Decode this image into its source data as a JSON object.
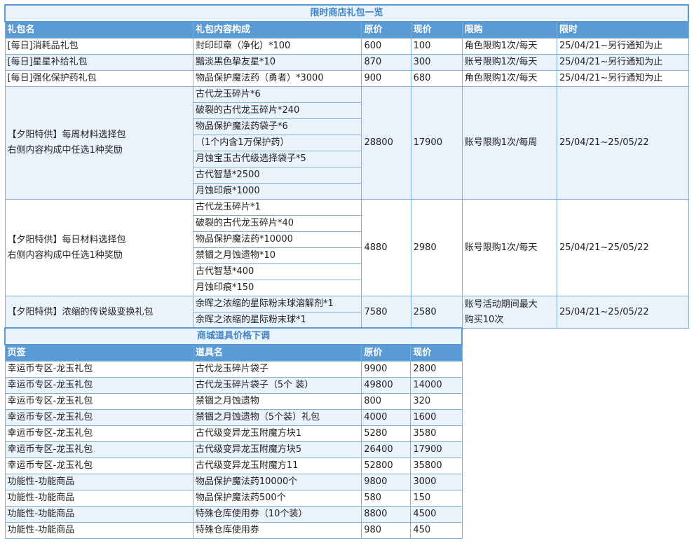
{
  "colors": {
    "header_bg": "#5b9bd5",
    "title_text": "#3e84c6",
    "alt_row": "#eaf2fb",
    "border": "#7fb0d8"
  },
  "table1": {
    "title": "限时商店礼包一览",
    "headers": [
      "礼包名",
      "礼包内容构成",
      "原价",
      "现价",
      "限购",
      "限时"
    ],
    "rows": [
      {
        "name": "[每日]消耗品礼包",
        "items": [
          "封印印章（净化）*100"
        ],
        "orig": "600",
        "now": "100",
        "limit": "角色限购1次/每天",
        "time": "25/04/21~另行通知为止"
      },
      {
        "name": "[每日]星星补给礼包",
        "items": [
          "黯淡黑色挚友星*10"
        ],
        "orig": "870",
        "now": "300",
        "limit": "账号限购1次/每天",
        "time": "25/04/21~另行通知为止"
      },
      {
        "name": "[每日]强化保护药礼包",
        "items": [
          "物品保护魔法药（勇者）*3000"
        ],
        "orig": "900",
        "now": "680",
        "limit": "角色限购1次/每天",
        "time": "25/04/21~另行通知为止"
      },
      {
        "name_l1": "【夕阳特供】每周材料选择包",
        "name_l2": "右侧内容构成中任选1种奖励",
        "items": [
          "古代龙玉碎片*6",
          "破裂的古代龙玉碎片*240",
          "物品保护魔法药袋子*6",
          "（1个内含1万保护药）",
          "月蚀宝玉古代级选择袋子*5",
          "古代智慧*2500",
          "月蚀印痕*1000"
        ],
        "orig": "28800",
        "now": "17900",
        "limit": "账号限购1次/每周",
        "time": "25/04/21~25/05/22"
      },
      {
        "name_l1": "【夕阳特供】每日材料选择包",
        "name_l2": "右侧内容构成中任选1种奖励",
        "items": [
          "古代龙玉碎片*1",
          "破裂的古代龙玉碎片*40",
          "物品保护魔法药*10000",
          "禁锢之月蚀遗物*10",
          "古代智慧*400",
          "月蚀印痕*150"
        ],
        "orig": "4880",
        "now": "2980",
        "limit": "账号限购1次/每天",
        "time": "25/04/21~25/05/22"
      },
      {
        "name": "【夕阳特供】浓缩的传说级变换礼包",
        "items": [
          "余晖之浓缩的星际粉末球溶解剂*1",
          "余晖之浓缩的星际粉末球*1"
        ],
        "orig": "7580",
        "now": "2580",
        "limit_l1": "账号活动期间最大",
        "limit_l2": "购买10次",
        "time": "25/04/21~25/05/22"
      }
    ]
  },
  "table2": {
    "title": "商城道具价格下调",
    "headers": [
      "页签",
      "道具名",
      "原价",
      "现价"
    ],
    "rows": [
      [
        "幸运币专区-龙玉礼包",
        "古代龙玉碎片袋子",
        "9900",
        "2800"
      ],
      [
        "幸运币专区-龙玉礼包",
        "古代龙玉碎片袋子（5个 装）",
        "49800",
        "14000"
      ],
      [
        "幸运币专区-龙玉礼包",
        "禁锢之月蚀遗物",
        "800",
        "320"
      ],
      [
        "幸运币专区-龙玉礼包",
        "禁锢之月蚀遗物（5个装）礼包",
        "4000",
        "1600"
      ],
      [
        "幸运币专区-龙玉礼包",
        "古代级变异龙玉附魔方块1",
        "5280",
        "3580"
      ],
      [
        "幸运币专区-龙玉礼包",
        "古代级变异龙玉附魔方块5",
        "26400",
        "17900"
      ],
      [
        "幸运币专区-龙玉礼包",
        "古代级变异龙玉附魔方11",
        "52800",
        "35800"
      ],
      [
        "功能性-功能商品",
        "物品保护魔法药10000个",
        "9800",
        "3000"
      ],
      [
        "功能性-功能商品",
        "物品保护魔法药500个",
        "580",
        "150"
      ],
      [
        "功能性-功能商品",
        "特殊仓库使用券（10个装）",
        "8800",
        "4500"
      ],
      [
        "功能性-功能商品",
        "特殊仓库使用券",
        "980",
        "450"
      ]
    ]
  }
}
